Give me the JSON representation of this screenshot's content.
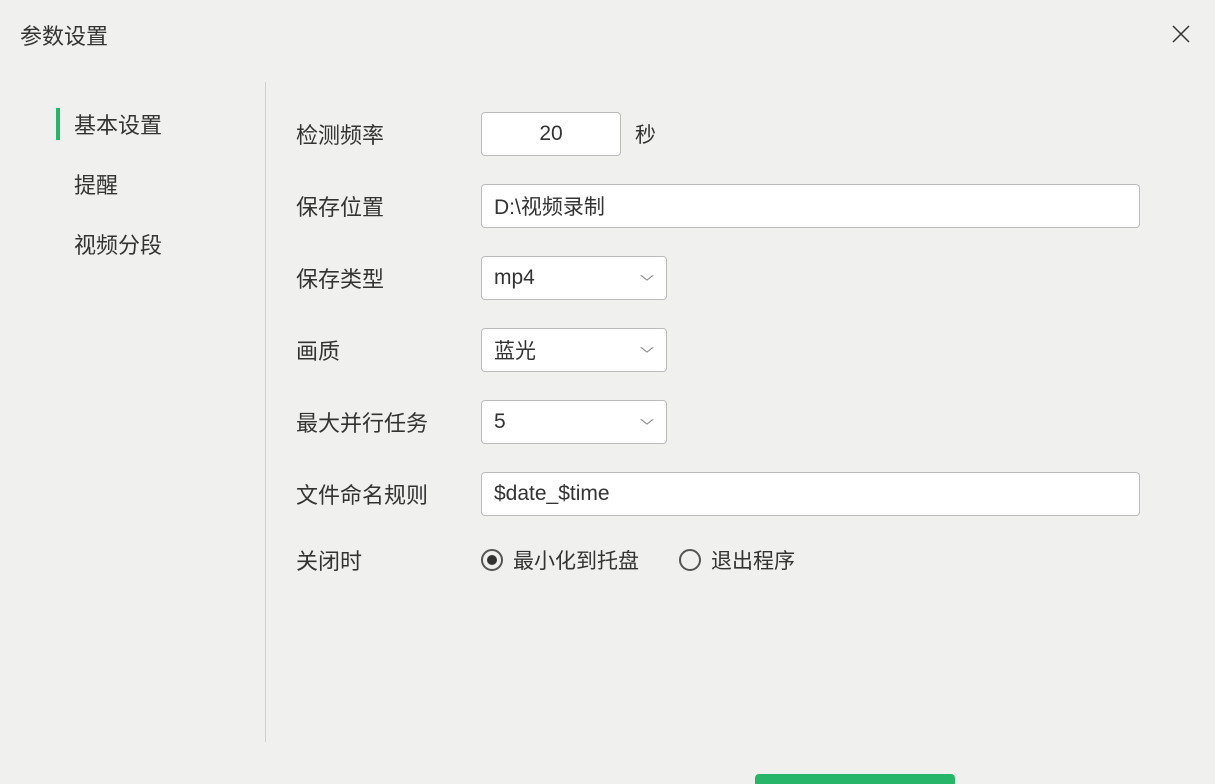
{
  "dialog": {
    "title": "参数设置"
  },
  "sidebar": {
    "items": [
      {
        "label": "基本设置",
        "active": true
      },
      {
        "label": "提醒",
        "active": false
      },
      {
        "label": "视频分段",
        "active": false
      }
    ]
  },
  "settings": {
    "detect_freq": {
      "label": "检测频率",
      "value": "20",
      "unit": "秒"
    },
    "save_path": {
      "label": "保存位置",
      "value": "D:\\视频录制"
    },
    "save_type": {
      "label": "保存类型",
      "value": "mp4"
    },
    "quality": {
      "label": "画质",
      "value": "蓝光"
    },
    "max_parallel": {
      "label": "最大并行任务",
      "value": "5"
    },
    "naming_rule": {
      "label": "文件命名规则",
      "value": "$date_$time"
    },
    "on_close": {
      "label": "关闭时",
      "options": [
        {
          "label": "最小化到托盘",
          "checked": true
        },
        {
          "label": "退出程序",
          "checked": false
        }
      ]
    }
  }
}
